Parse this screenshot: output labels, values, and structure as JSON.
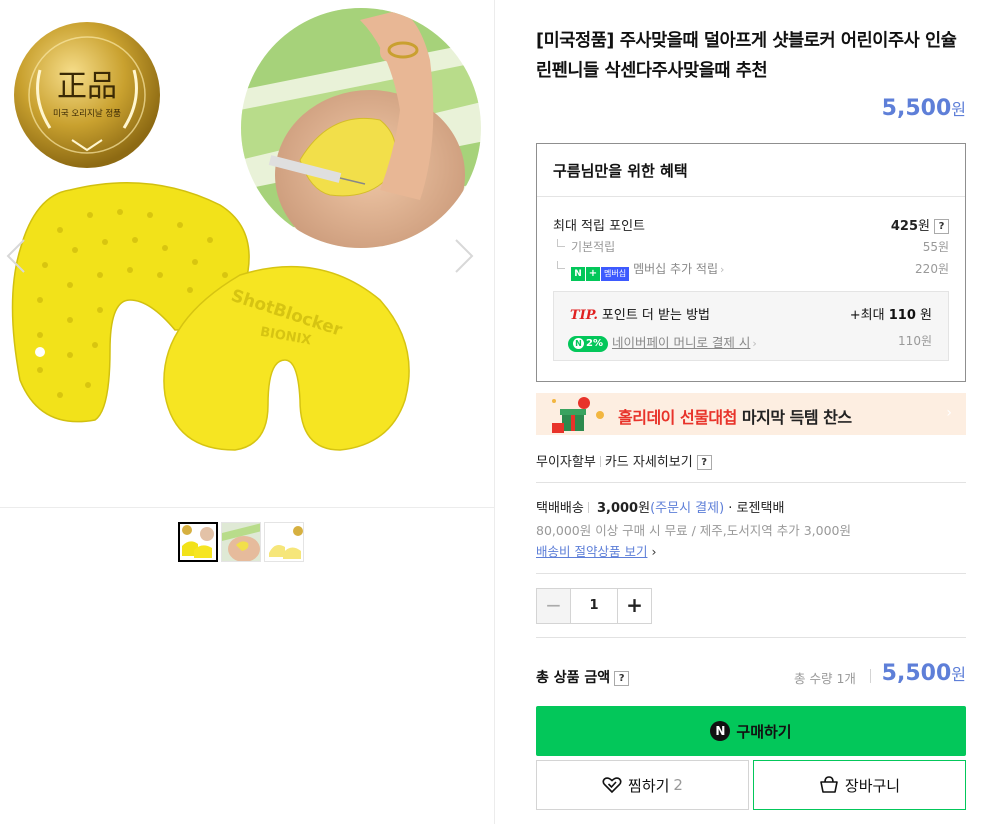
{
  "gallery": {
    "badge_text_big": "正品",
    "badge_text_small": "미국 오리지날 정품",
    "product_text": "ShotBlocker",
    "product_brand": "BIONIX",
    "thumbnails": [
      "thumb-1",
      "thumb-2",
      "thumb-3"
    ],
    "active_thumb": 1
  },
  "product": {
    "title": "[미국정품] 주사맞을때 덜아프게 샷블로커 어린이주사 인슐린펜니들 삭센다주사맞을때 추천",
    "price": "5,500",
    "currency": "원"
  },
  "benefits": {
    "heading": "구름님만을 위한 혜택",
    "max_points_label": "최대 적립 포인트",
    "max_points_value": "425",
    "max_points_unit": "원",
    "help": "?",
    "basic_label": "기본적립",
    "basic_value": "55원",
    "membership_badge": "멤버십",
    "membership_label": "멤버십 추가 적립",
    "membership_value": "220원",
    "tip": {
      "tag": "TIP.",
      "label": "포인트 더 받는 방법",
      "bonus_prefix": "+최대",
      "bonus_value": "110",
      "bonus_unit": "원",
      "pay_badge": "2%",
      "pay_label": "네이버페이 머니로 결제 시",
      "pay_value": "110원"
    }
  },
  "banner": {
    "highlight": "홀리데이 선물대첩",
    "rest": " 마지막 득템 찬스"
  },
  "installment": {
    "no_interest": "무이자할부",
    "card_details": "카드 자세히보기",
    "help": "?"
  },
  "shipping": {
    "method": "택배배송",
    "fee": "3,000",
    "fee_unit": "원",
    "fee_note": "(주문시 결제)",
    "carrier": "· 로젠택배",
    "free_condition": "80,000원 이상 구매 시 무료 / 제주,도서지역 추가 3,000원",
    "saving_link": "배송비 절약상품 보기"
  },
  "quantity": {
    "minus": "−",
    "value": "1",
    "plus": "+"
  },
  "total": {
    "label": "총 상품 금액",
    "help": "?",
    "qty_text": "총 수량 1개",
    "price": "5,500",
    "currency": "원"
  },
  "actions": {
    "buy_icon": "N",
    "buy_label": "구매하기",
    "wish_label": "찜하기",
    "wish_count": "2",
    "cart_label": "장바구니"
  },
  "colors": {
    "accent_blue": "#5e7fd8",
    "naver_green": "#03c75a",
    "tip_red": "#e02020",
    "product_yellow": "#f2e21a"
  }
}
